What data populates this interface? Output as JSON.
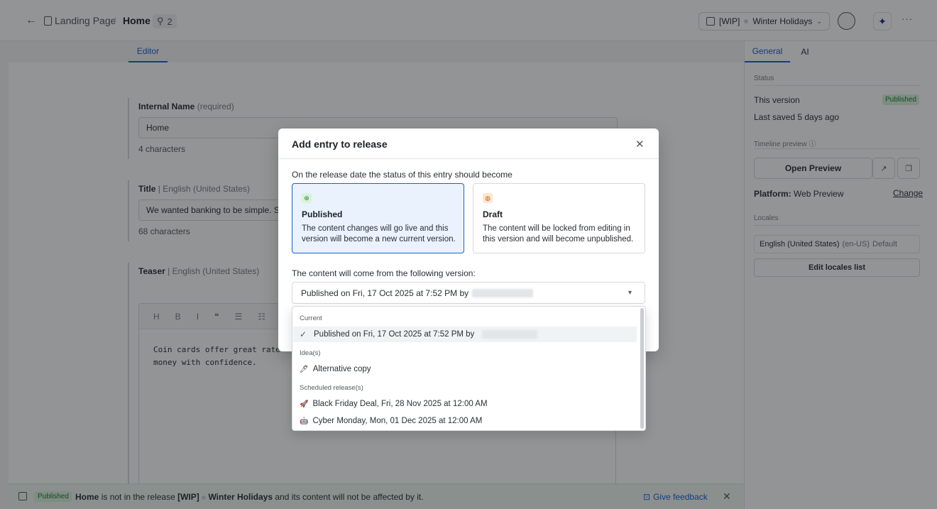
{
  "header": {
    "breadcrumb": "Landing Page",
    "title": "Home",
    "ref_count": "2",
    "release_prefix": "[WIP]",
    "release_name": "Winter Holidays"
  },
  "editor": {
    "tab": "Editor",
    "fields": [
      {
        "label": "Internal Name",
        "hint": "(required)",
        "value": "Home",
        "count": "4 characters"
      },
      {
        "label": "Title",
        "hint": "English (United States)",
        "value": "We wanted banking to be simple. So w",
        "count": "68 characters"
      },
      {
        "label": "Teaser",
        "hint": "English (United States)"
      }
    ],
    "rte_toolbar": [
      "H",
      "B",
      "I",
      "❝",
      "☰",
      "☷"
    ],
    "rte_lines": [
      "Coin cards offer great rate",
      "money with confidence."
    ]
  },
  "sidebar": {
    "tabs": [
      "General",
      "AI"
    ],
    "status_heading": "Status",
    "this_version": "This version",
    "status_badge": "Published",
    "last_saved": "Last saved 5 days ago",
    "timeline_heading": "Timeline preview",
    "open_preview": "Open Preview",
    "platform_label": "Platform:",
    "platform_value": "Web Preview",
    "change": "Change",
    "locales_heading": "Locales",
    "locale_name": "English (United States)",
    "locale_code": "(en-US)",
    "locale_default": "Default",
    "edit_locales": "Edit locales list"
  },
  "banner": {
    "badge": "Published",
    "entry": "Home",
    "text1": "is not in the release",
    "release_prefix": "[WIP]",
    "release_name": "Winter Holidays",
    "text2": "and its content will not be affected by it.",
    "feedback": "Give feedback"
  },
  "modal": {
    "title": "Add entry to release",
    "question": "On the release date the status of this entry should become",
    "options": [
      {
        "title": "Published",
        "desc": "The content changes will go live and this version will become a new current version.",
        "icon": "globe-icon"
      },
      {
        "title": "Draft",
        "desc": "The content will be locked from editing in this version and will become unpublished.",
        "icon": "palette-icon"
      }
    ],
    "version_question": "The content will come from the following version:",
    "selected_version": "Published on Fri, 17 Oct 2025 at 7:52 PM by"
  },
  "dropdown": {
    "current_heading": "Current",
    "current_item": "Published on Fri, 17 Oct 2025 at 7:52 PM by",
    "ideas_heading": "Idea(s)",
    "idea_item": "Alternative copy",
    "scheduled_heading": "Scheduled release(s)",
    "scheduled_items": [
      "Black Friday Deal, Fri, 28 Nov 2025 at 12:00 AM",
      "Cyber Monday, Mon, 01 Dec 2025 at 12:00 AM"
    ]
  },
  "colors": {
    "accent": "#1a5fd1",
    "success": "#1d8a3b",
    "published_bg": "#d9f2dc"
  }
}
